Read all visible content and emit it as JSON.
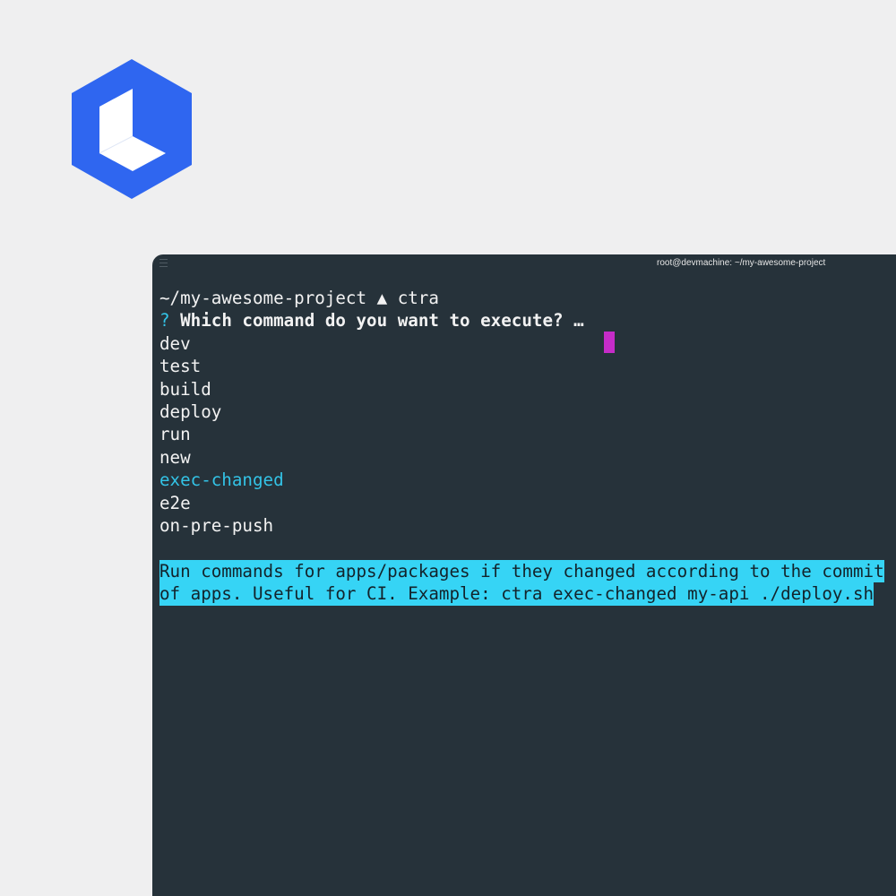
{
  "brand": {
    "logo_icon": "hexagon-cube-logo",
    "logo_color": "#2f66f0"
  },
  "terminal": {
    "title": "root@devmachine: ~/my-awesome-project",
    "prompt_line": "~/my-awesome-project ▲ ctra",
    "question_mark": "?",
    "question": "Which command do you want to execute? …",
    "commands": [
      {
        "label": "dev",
        "selected": false
      },
      {
        "label": "test",
        "selected": false
      },
      {
        "label": "build",
        "selected": false
      },
      {
        "label": "deploy",
        "selected": false
      },
      {
        "label": "run",
        "selected": false
      },
      {
        "label": "new",
        "selected": false
      },
      {
        "label": "exec-changed",
        "selected": true
      },
      {
        "label": "e2e",
        "selected": false
      },
      {
        "label": "on-pre-push",
        "selected": false
      }
    ],
    "description_lines": [
      "Run commands for apps/packages if they changed according to the commit",
      "of apps. Useful for CI. Example: ctra exec-changed my-api ./deploy.sh"
    ],
    "colors": {
      "background": "#26323a",
      "accent": "#33c3e6",
      "highlight": "#36d4f5",
      "cursor": "#c62cc8"
    }
  }
}
